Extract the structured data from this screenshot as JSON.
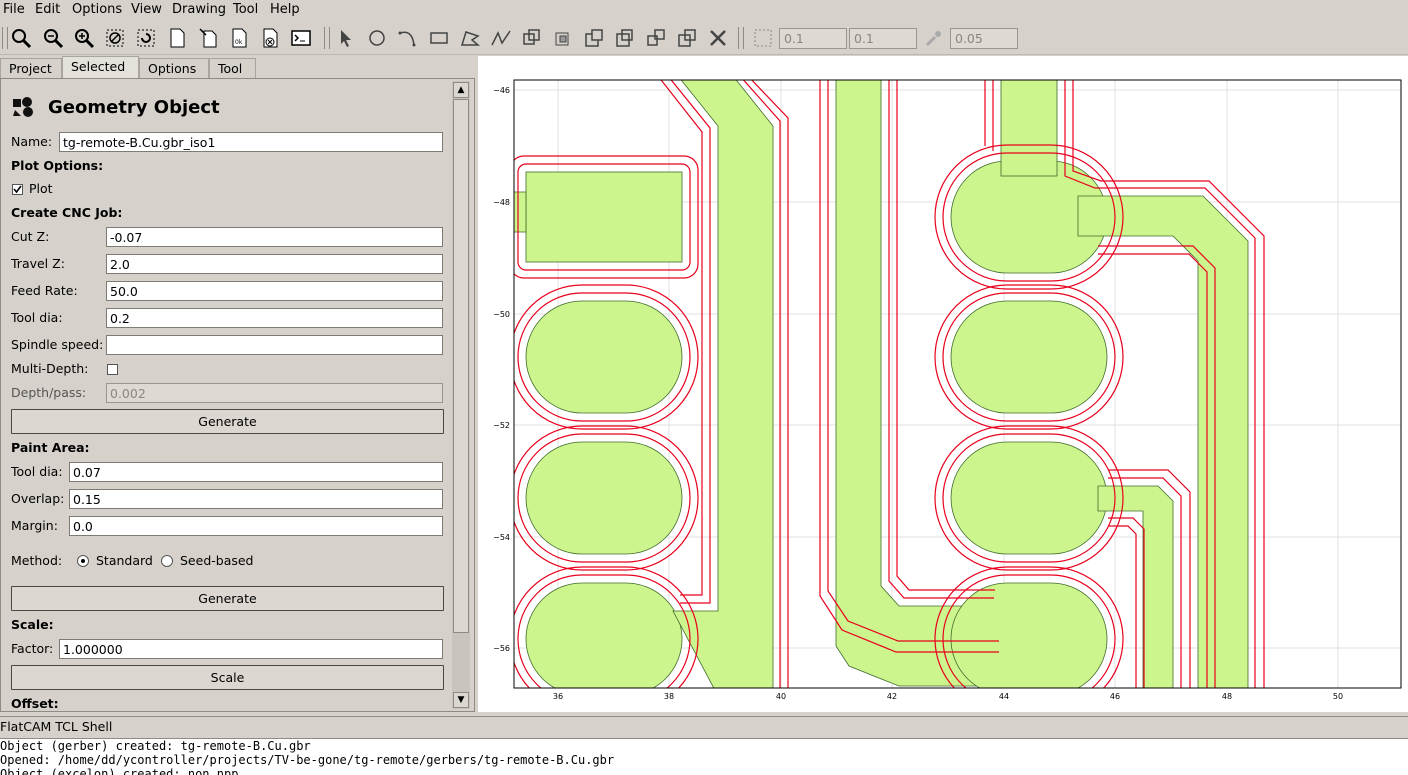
{
  "menu": [
    "File",
    "Edit",
    "Options",
    "View",
    "Drawing",
    "Tool",
    "Help"
  ],
  "toolbar": {
    "grid_x": "0.1",
    "grid_y": "0.1",
    "snap_max": "0.05"
  },
  "tabs": [
    "Project",
    "Selected",
    "Options",
    "Tool"
  ],
  "panel": {
    "title": "Geometry Object",
    "name_label": "Name:",
    "name_value": "tg-remote-B.Cu.gbr_iso1",
    "plot_options": "Plot Options:",
    "plot_label": "Plot",
    "cnc_title": "Create CNC Job:",
    "cutz_label": "Cut Z:",
    "cutz_value": "-0.07",
    "travelz_label": "Travel Z:",
    "travelz_value": "2.0",
    "feed_label": "Feed Rate:",
    "feed_value": "50.0",
    "tooldia_label": "Tool dia:",
    "tooldia_value": "0.2",
    "spindle_label": "Spindle speed:",
    "spindle_value": "",
    "multidepth_label": "Multi-Depth:",
    "depth_label": "Depth/pass:",
    "depth_value": "0.002",
    "generate_label": "Generate",
    "paint_title": "Paint Area:",
    "paint_tooldia_label": "Tool dia:",
    "paint_tooldia_value": "0.07",
    "overlap_label": "Overlap:",
    "overlap_value": "0.15",
    "margin_label": "Margin:",
    "margin_value": "0.0",
    "method_label": "Method:",
    "method_standard": "Standard",
    "method_seed": "Seed-based",
    "generate2_label": "Generate",
    "scale_title": "Scale:",
    "factor_label": "Factor:",
    "factor_value": "1.000000",
    "scale_button": "Scale",
    "offset_title": "Offset:"
  },
  "plot": {
    "x_ticks": [
      "36",
      "38",
      "40",
      "42",
      "44",
      "46",
      "48",
      "50"
    ],
    "y_ticks": [
      "−46",
      "−48",
      "−50",
      "−52",
      "−54",
      "−56"
    ],
    "copper_color": "#cdf58e",
    "iso_color": "#e8001c"
  },
  "shell": {
    "title": "FlatCAM TCL Shell",
    "lines": [
      "Object (gerber) created: tg-remote-B.Cu.gbr",
      "Opened: /home/dd/ycontroller/projects/TV-be-gone/tg-remote/gerbers/tg-remote-B.Cu.gbr",
      "Object (excelon) created: non.npp"
    ]
  }
}
